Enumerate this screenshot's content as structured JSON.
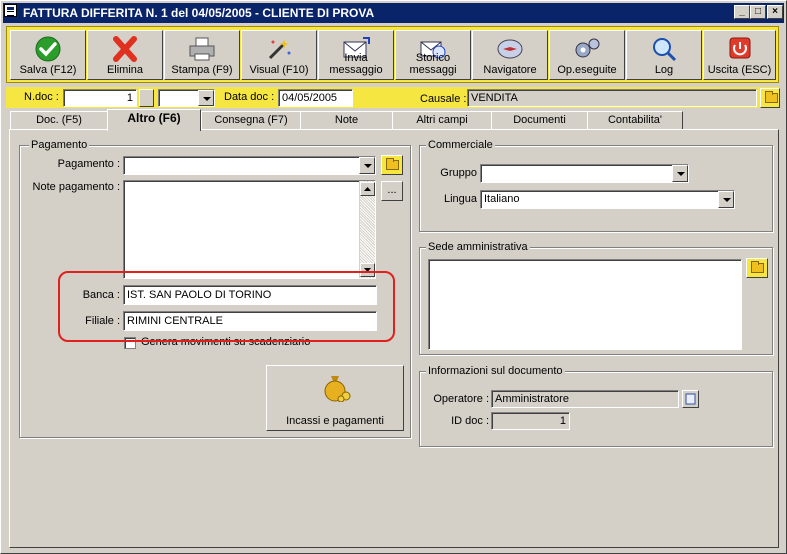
{
  "window": {
    "title": "FATTURA DIFFERITA N. 1  del 04/05/2005 - CLIENTE DI PROVA",
    "controls": [
      "_",
      "□",
      "×"
    ]
  },
  "toolbar": [
    {
      "label": "Salva (F12)",
      "icon": "check-icon"
    },
    {
      "label": "Elimina",
      "icon": "red-x-icon"
    },
    {
      "label": "Stampa (F9)",
      "icon": "printer-icon"
    },
    {
      "label": "Visual (F10)",
      "icon": "magic-wand-icon"
    },
    {
      "label": "Invia\nmessaggio",
      "icon": "envelope-send-icon"
    },
    {
      "label": "Storico\nmessaggi",
      "icon": "envelope-history-icon"
    },
    {
      "label": "Navigatore",
      "icon": "compass-icon"
    },
    {
      "label": "Op.eseguite",
      "icon": "gears-icon"
    },
    {
      "label": "Log",
      "icon": "magnifier-book-icon"
    },
    {
      "label": "Uscita (ESC)",
      "icon": "power-icon"
    }
  ],
  "header": {
    "ndoc_label": "N.doc :",
    "ndoc_value": "1",
    "datadoc_label": "Data doc :",
    "datadoc_value": "04/05/2005",
    "causale_label": "Causale :",
    "causale_value": "VENDITA"
  },
  "tabs": [
    {
      "label": "Doc. (F5)",
      "active": false
    },
    {
      "label": "Altro (F6)",
      "active": true
    },
    {
      "label": "Consegna (F7)",
      "active": false
    },
    {
      "label": "Note",
      "active": false
    },
    {
      "label": "Altri campi",
      "active": false
    },
    {
      "label": "Documenti",
      "active": false
    },
    {
      "label": "Contabilita'",
      "active": false
    }
  ],
  "pagamento": {
    "group_label": "Pagamento",
    "pagamento_label": "Pagamento :",
    "pagamento_value": "",
    "note_label": "Note pagamento :",
    "note_value": "",
    "ellipsis": "...",
    "banca_label": "Banca :",
    "banca_value": "IST. SAN PAOLO DI TORINO",
    "filiale_label": "Filiale :",
    "filiale_value": "RIMINI CENTRALE",
    "genera_label": "Genera movimenti su scadenziario",
    "genera_checked": false,
    "incassi_label": "Incassi e pagamenti"
  },
  "commerciale": {
    "group_label": "Commerciale",
    "gruppo_label": "Gruppo",
    "gruppo_value": "",
    "lingua_label": "Lingua",
    "lingua_value": "Italiano"
  },
  "sede": {
    "group_label": "Sede amministrativa",
    "value": ""
  },
  "info_doc": {
    "group_label": "Informazioni sul documento",
    "operatore_label": "Operatore :",
    "operatore_value": "Amministratore",
    "iddoc_label": "ID doc :",
    "iddoc_value": "1"
  },
  "colors": {
    "title_bar": "#0a246a",
    "toolbar_bg": "#f5e642",
    "window_bg": "#d4d0c8",
    "highlight": "#e0201c"
  }
}
